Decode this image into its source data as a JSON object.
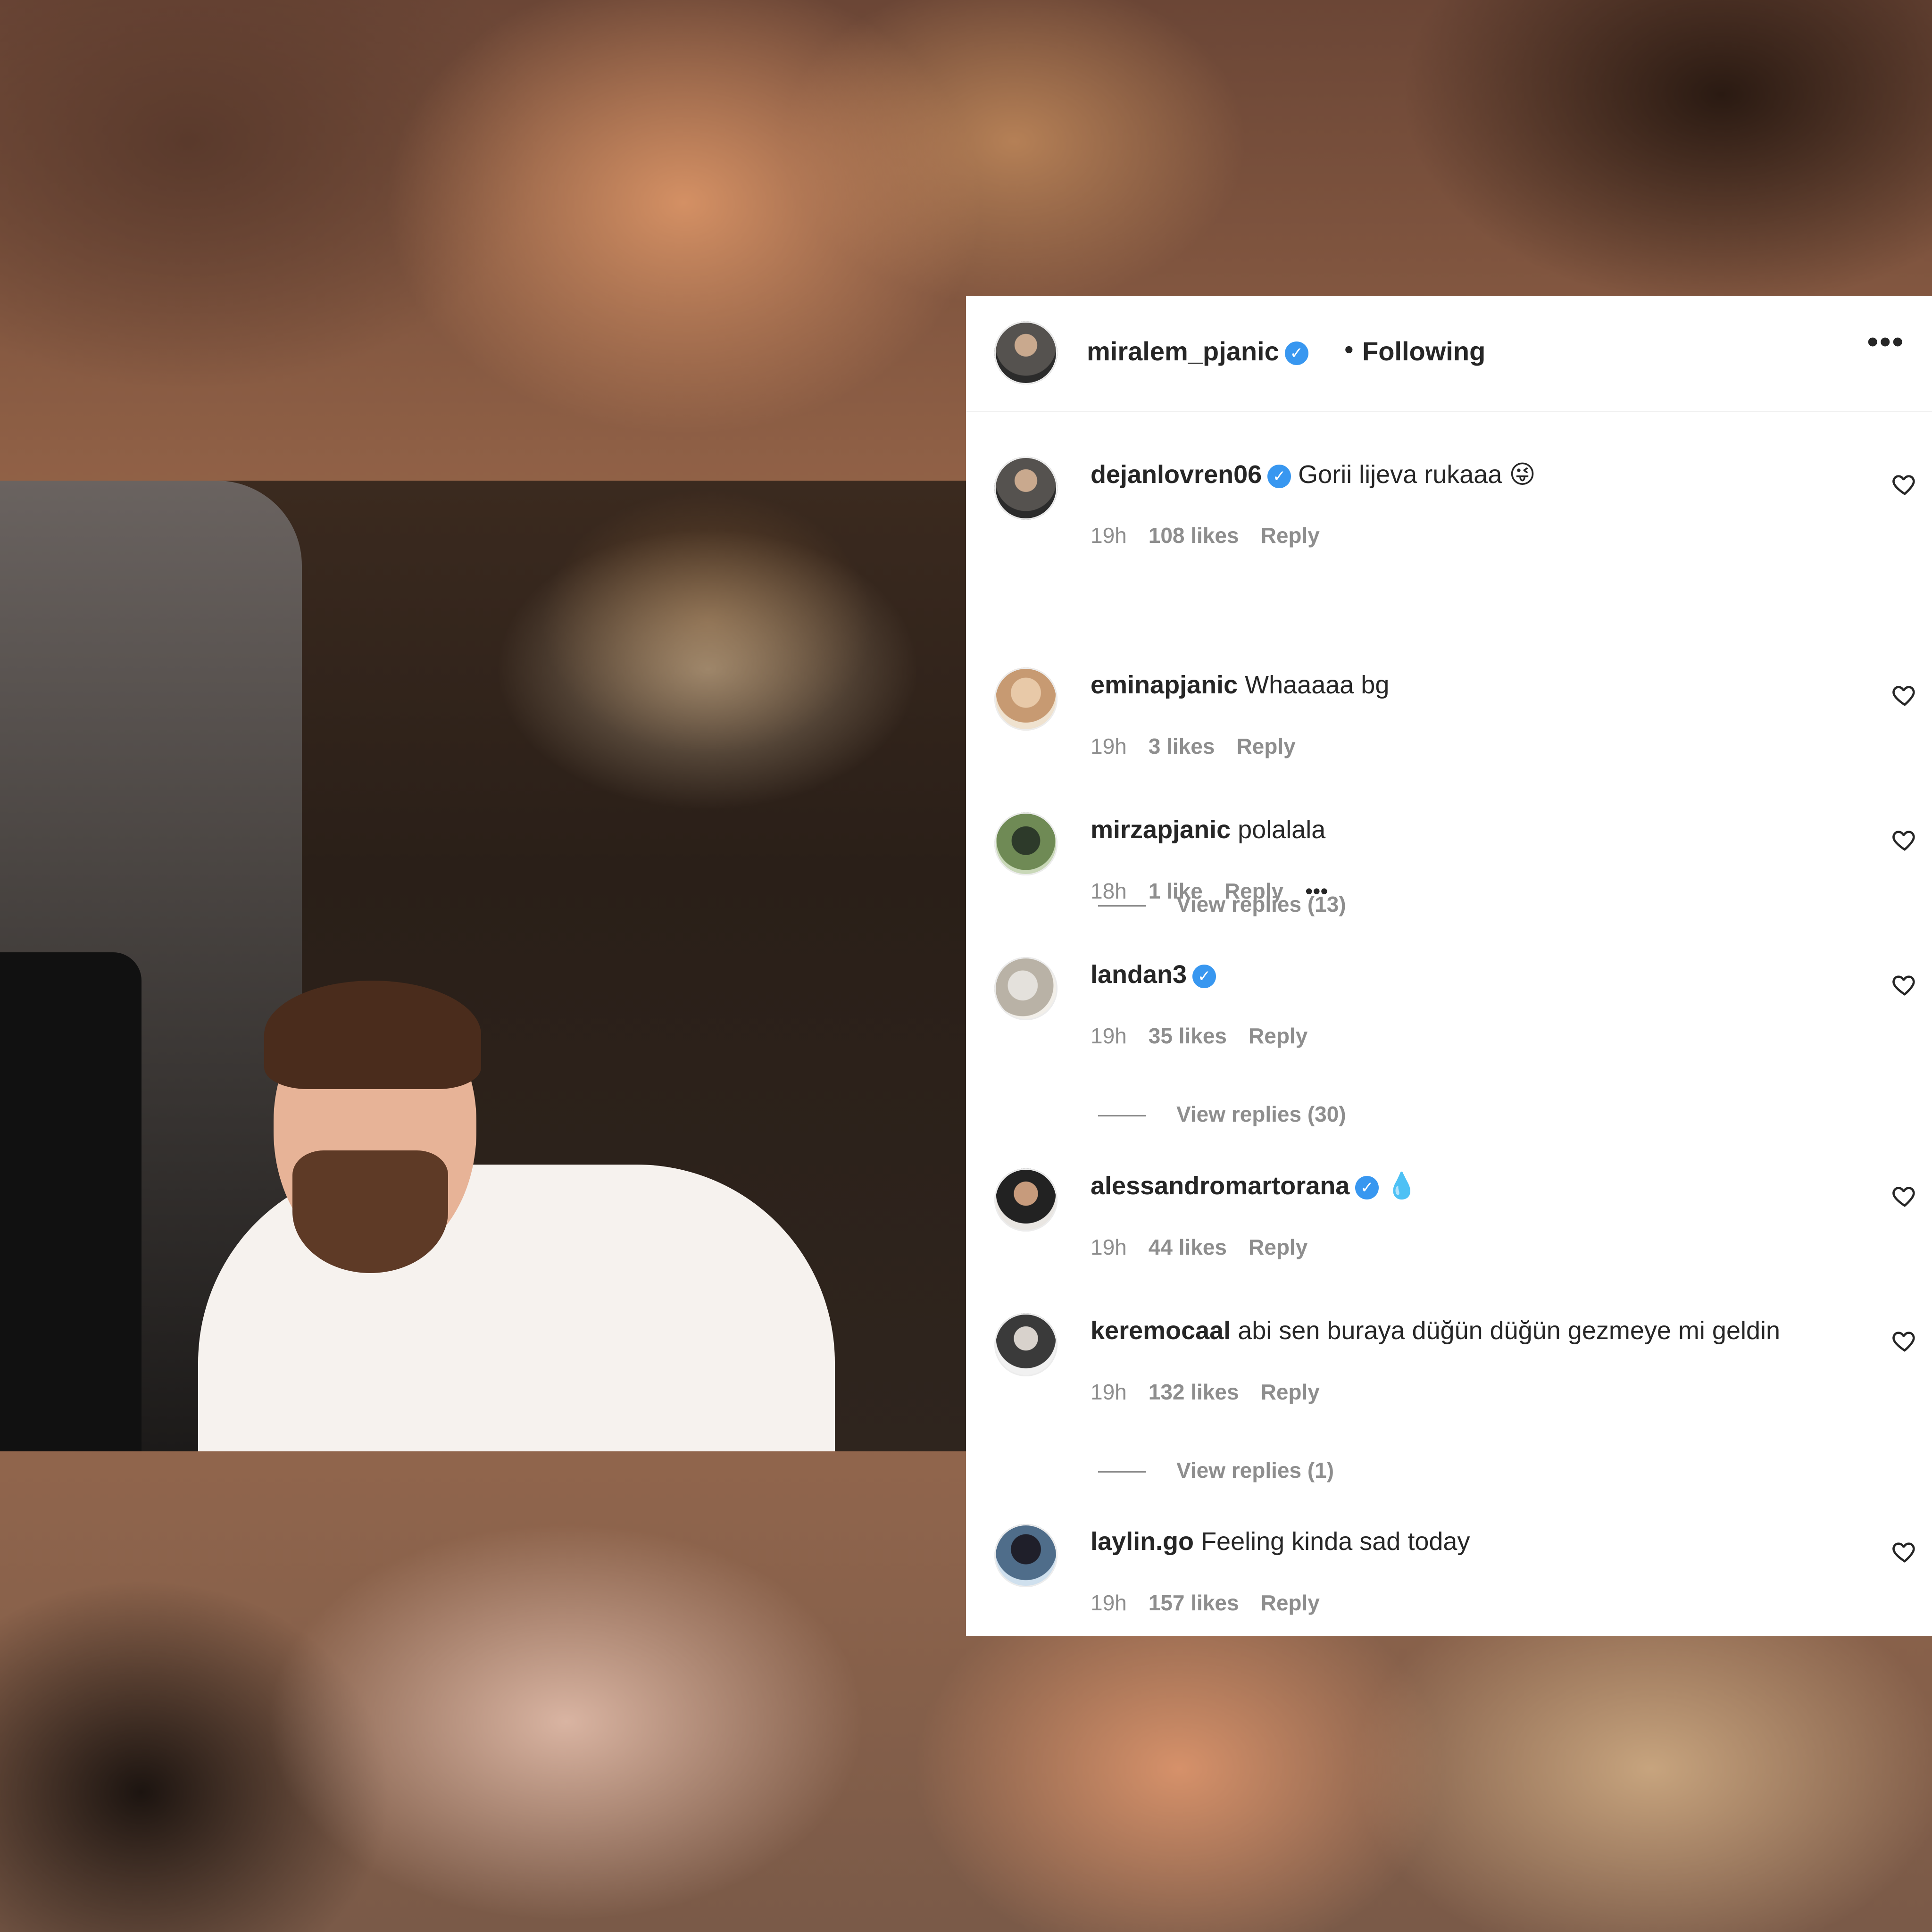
{
  "post": {
    "author": "miralem_pjanic",
    "separator": "•",
    "follow_status": "Following",
    "more_icon": "•••"
  },
  "comments": [
    {
      "user": "dejanlovren06",
      "verified": true,
      "text": "Gorii lijeva rukaaa 😜",
      "time": "19h",
      "likes": "108 likes",
      "reply": "Reply",
      "view_replies": "View replies (13)"
    },
    {
      "user": "eminapjanic",
      "verified": false,
      "text": "Whaaaaa bg",
      "time": "19h",
      "likes": "3 likes",
      "reply": "Reply"
    },
    {
      "user": "mirzapjanic",
      "verified": false,
      "text": "polalala",
      "time": "18h",
      "likes": "1 like",
      "reply": "Reply",
      "options": "•••"
    },
    {
      "user": "landan3",
      "verified": true,
      "text": "",
      "time": "19h",
      "likes": "35 likes",
      "reply": "Reply",
      "view_replies": "View replies (30)"
    },
    {
      "user": "alessandromartorana",
      "verified": true,
      "text": "💧",
      "time": "19h",
      "likes": "44 likes",
      "reply": "Reply"
    },
    {
      "user": "keremocaal",
      "verified": false,
      "text": "abi sen buraya düğün düğün gezmeye mi geldin",
      "time": "19h",
      "likes": "132 likes",
      "reply": "Reply",
      "view_replies": "View replies (1)"
    },
    {
      "user": "laylin.go",
      "verified": false,
      "text": "Feeling kinda sad today",
      "time": "19h",
      "likes": "157 likes",
      "reply": "Reply"
    }
  ],
  "icons": {
    "verified": "verified-badge-icon",
    "heart": "heart-outline-icon",
    "more": "more-dots-icon"
  },
  "colors": {
    "verified_blue": "#3897f0",
    "text_primary": "#262626",
    "text_secondary": "#8e8e8e"
  }
}
